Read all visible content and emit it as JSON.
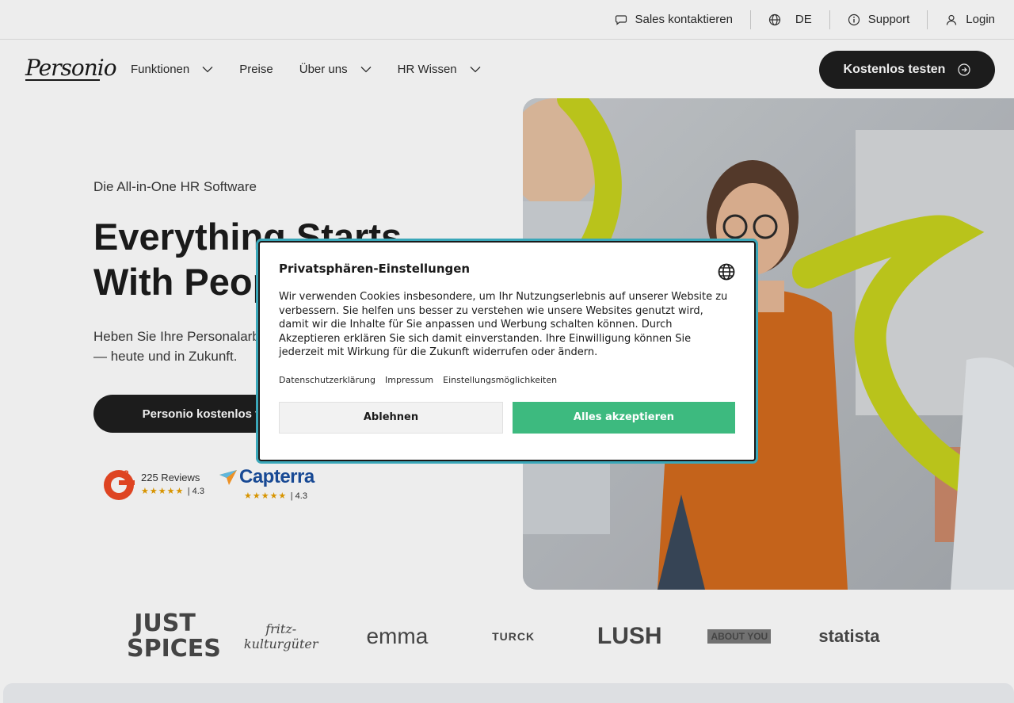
{
  "topbar": {
    "sales": "Sales kontaktieren",
    "language": "DE",
    "support": "Support",
    "login": "Login"
  },
  "nav": {
    "logo": "Personio",
    "items": [
      {
        "label": "Funktionen",
        "has_dropdown": true
      },
      {
        "label": "Preise",
        "has_dropdown": false
      },
      {
        "label": "Über uns",
        "has_dropdown": true
      },
      {
        "label": "HR Wissen",
        "has_dropdown": true
      }
    ],
    "cta": "Kostenlos testen"
  },
  "hero": {
    "eyebrow": "Die All-in-One HR Software",
    "headline_1": "Everything Starts",
    "headline_2": "With People",
    "subline_1": "Heben Sie Ihre Personalarbeit",
    "subline_2": "— heute und in Zukunft.",
    "cta": "Personio kostenlos testen",
    "ratings": {
      "g2": {
        "reviews": "225 Reviews",
        "stars": "★★★★★",
        "score": "| 4.3"
      },
      "capterra": {
        "name": "Capterra",
        "stars": "★★★★★",
        "score": "| 4.3"
      }
    }
  },
  "logos": [
    "JUST SPICES",
    "fritz-kulturgüter",
    "emma",
    "TURCK",
    "LUSH",
    "ABOUT YOU",
    "statista"
  ],
  "cookie_dialog": {
    "title": "Privatsphären-Einstellungen",
    "text": "Wir verwenden Cookies insbesondere, um Ihr Nutzungserlebnis auf unserer Website zu verbessern. Sie helfen uns besser zu verstehen wie unsere Websites genutzt wird, damit wir die Inhalte für Sie anpassen und Werbung schalten können. Durch Akzeptieren erklären Sie sich damit einverstanden. Ihre Einwilligung können Sie jederzeit mit Wirkung für die Zukunft widerrufen oder ändern.",
    "links": [
      "Datenschutzerklärung",
      "Impressum",
      "Einstellungsmöglichkeiten"
    ],
    "deny": "Ablehnen",
    "accept": "Alles akzeptieren"
  },
  "colors": {
    "accent_green": "#3dba7f",
    "dark_button": "#1f1f1f",
    "focus_ring": "#3aa7b9",
    "lime": "#c8d21e"
  }
}
